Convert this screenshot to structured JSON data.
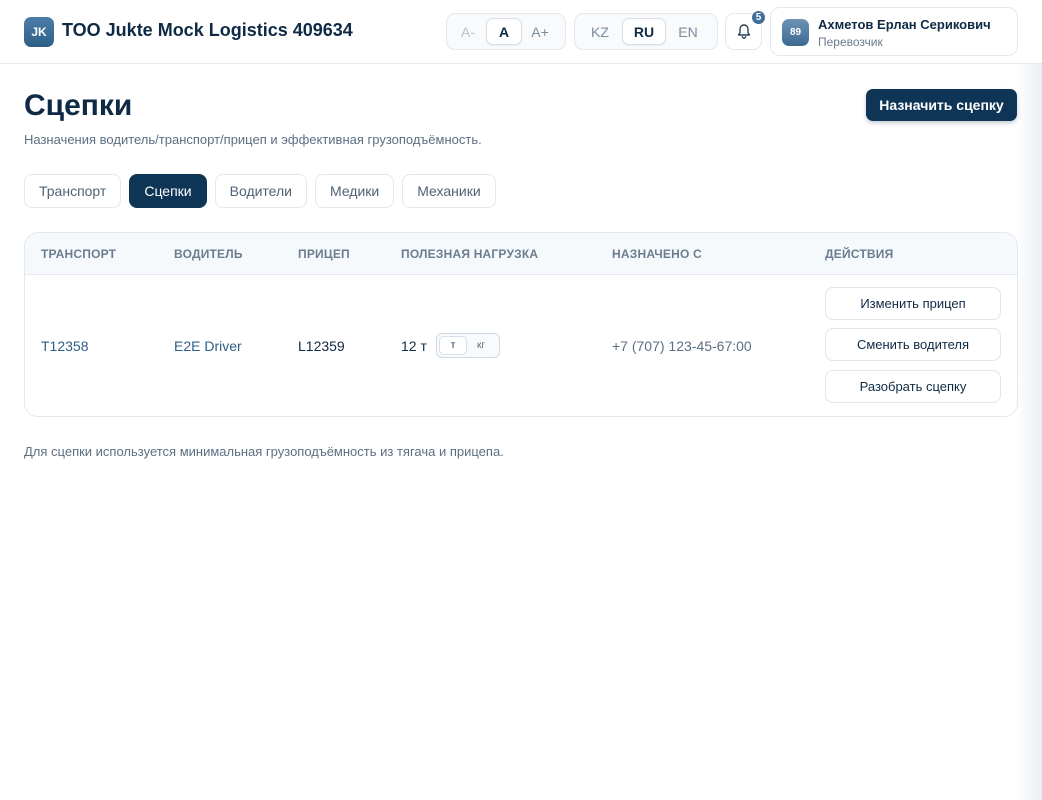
{
  "header": {
    "logo_initials": "JK",
    "company_name": "TOO Jukte Mock Logistics 409634",
    "font_size_controls": [
      {
        "label": "A-",
        "state": "disabled"
      },
      {
        "label": "A",
        "state": "active"
      },
      {
        "label": "A+",
        "state": "normal"
      }
    ],
    "languages": [
      {
        "label": "KZ",
        "state": "normal"
      },
      {
        "label": "RU",
        "state": "active"
      },
      {
        "label": "EN",
        "state": "normal"
      }
    ],
    "notifications": {
      "icon": "bell-icon",
      "count": "5"
    },
    "user": {
      "avatar_text": "89",
      "name": "Ахметов Ерлан Серикович",
      "role": "Перевозчик"
    }
  },
  "page": {
    "title": "Сцепки",
    "subtitle": "Назначения водитель/транспорт/прицеп и эффективная грузоподъёмность.",
    "primary_action": "Назначить сцепку",
    "tabs": [
      {
        "label": "Транспорт",
        "active": false
      },
      {
        "label": "Сцепки",
        "active": true
      },
      {
        "label": "Водители",
        "active": false
      },
      {
        "label": "Медики",
        "active": false
      },
      {
        "label": "Механики",
        "active": false
      }
    ]
  },
  "table": {
    "columns": [
      "ТРАНСПОРТ",
      "ВОДИТЕЛЬ",
      "ПРИЦЕП",
      "ПОЛЕЗНАЯ НАГРУЗКА",
      "НАЗНАЧЕНО С",
      "ДЕЙСТВИЯ"
    ],
    "rows": [
      {
        "transport": "T12358",
        "driver": "E2E Driver",
        "trailer": "L12359",
        "payload": "12 т",
        "payload_units": [
          {
            "label": "т",
            "active": true
          },
          {
            "label": "кг",
            "active": false
          }
        ],
        "assigned_since": "+7 (707) 123-45-67:00",
        "actions": [
          "Изменить прицеп",
          "Сменить водителя",
          "Разобрать сцепку"
        ]
      }
    ]
  },
  "footnote": "Для сцепки используется минимальная грузоподъёмность из тягача и прицепа.",
  "colors": {
    "primary": "#0f3556",
    "link": "#2f5f87",
    "border": "#e2e8ef",
    "text": "#0f2a45",
    "muted": "#5d6f82"
  }
}
